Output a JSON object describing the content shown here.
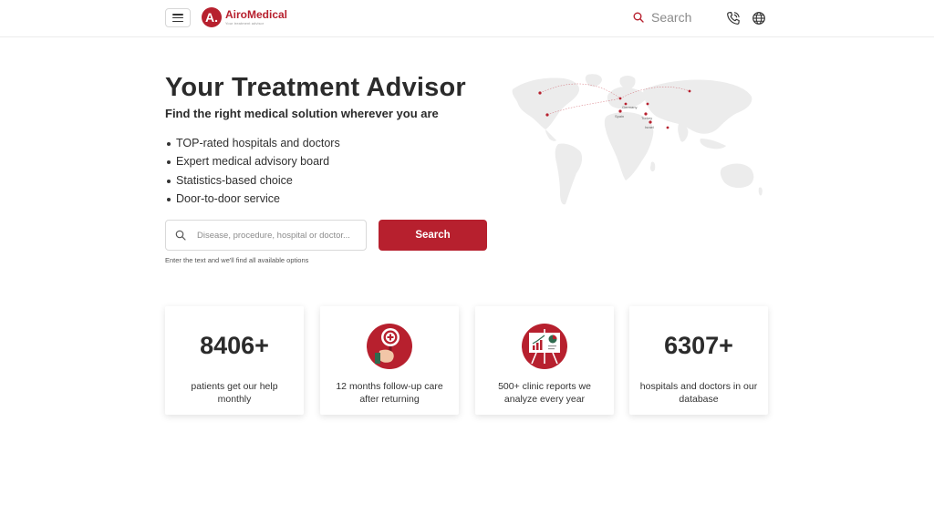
{
  "header": {
    "brand_mark": "A.",
    "brand_name": "AiroMedical",
    "brand_tagline": "Your treatment advisor",
    "search_label": "Search",
    "icons": [
      "menu-icon",
      "search-icon",
      "phone-icon",
      "globe-icon"
    ]
  },
  "hero": {
    "title": "Your Treatment Advisor",
    "subtitle": "Find the right medical solution wherever you are",
    "bullets": [
      "TOP-rated hospitals and doctors",
      "Expert medical advisory board",
      "Statistics-based choice",
      "Door-to-door service"
    ],
    "search_placeholder": "Disease, procedure, hospital or doctor...",
    "search_button": "Search",
    "hint": "Enter the text and we'll find all available options"
  },
  "map": {
    "labels": [
      "Germany",
      "Spain",
      "Turkey",
      "Israel"
    ]
  },
  "stats": [
    {
      "number": "8406+",
      "text": "patients get our help monthly"
    },
    {
      "icon": "magnifier-hand-icon",
      "text": "12 months follow-up care after returning"
    },
    {
      "icon": "report-easel-icon",
      "text": "500+ clinic reports we analyze every year"
    },
    {
      "number": "6307+",
      "text": "hospitals and doctors in our database"
    }
  ],
  "colors": {
    "accent": "#b7202e",
    "text": "#2b2b2b",
    "map_land": "#ececec"
  }
}
